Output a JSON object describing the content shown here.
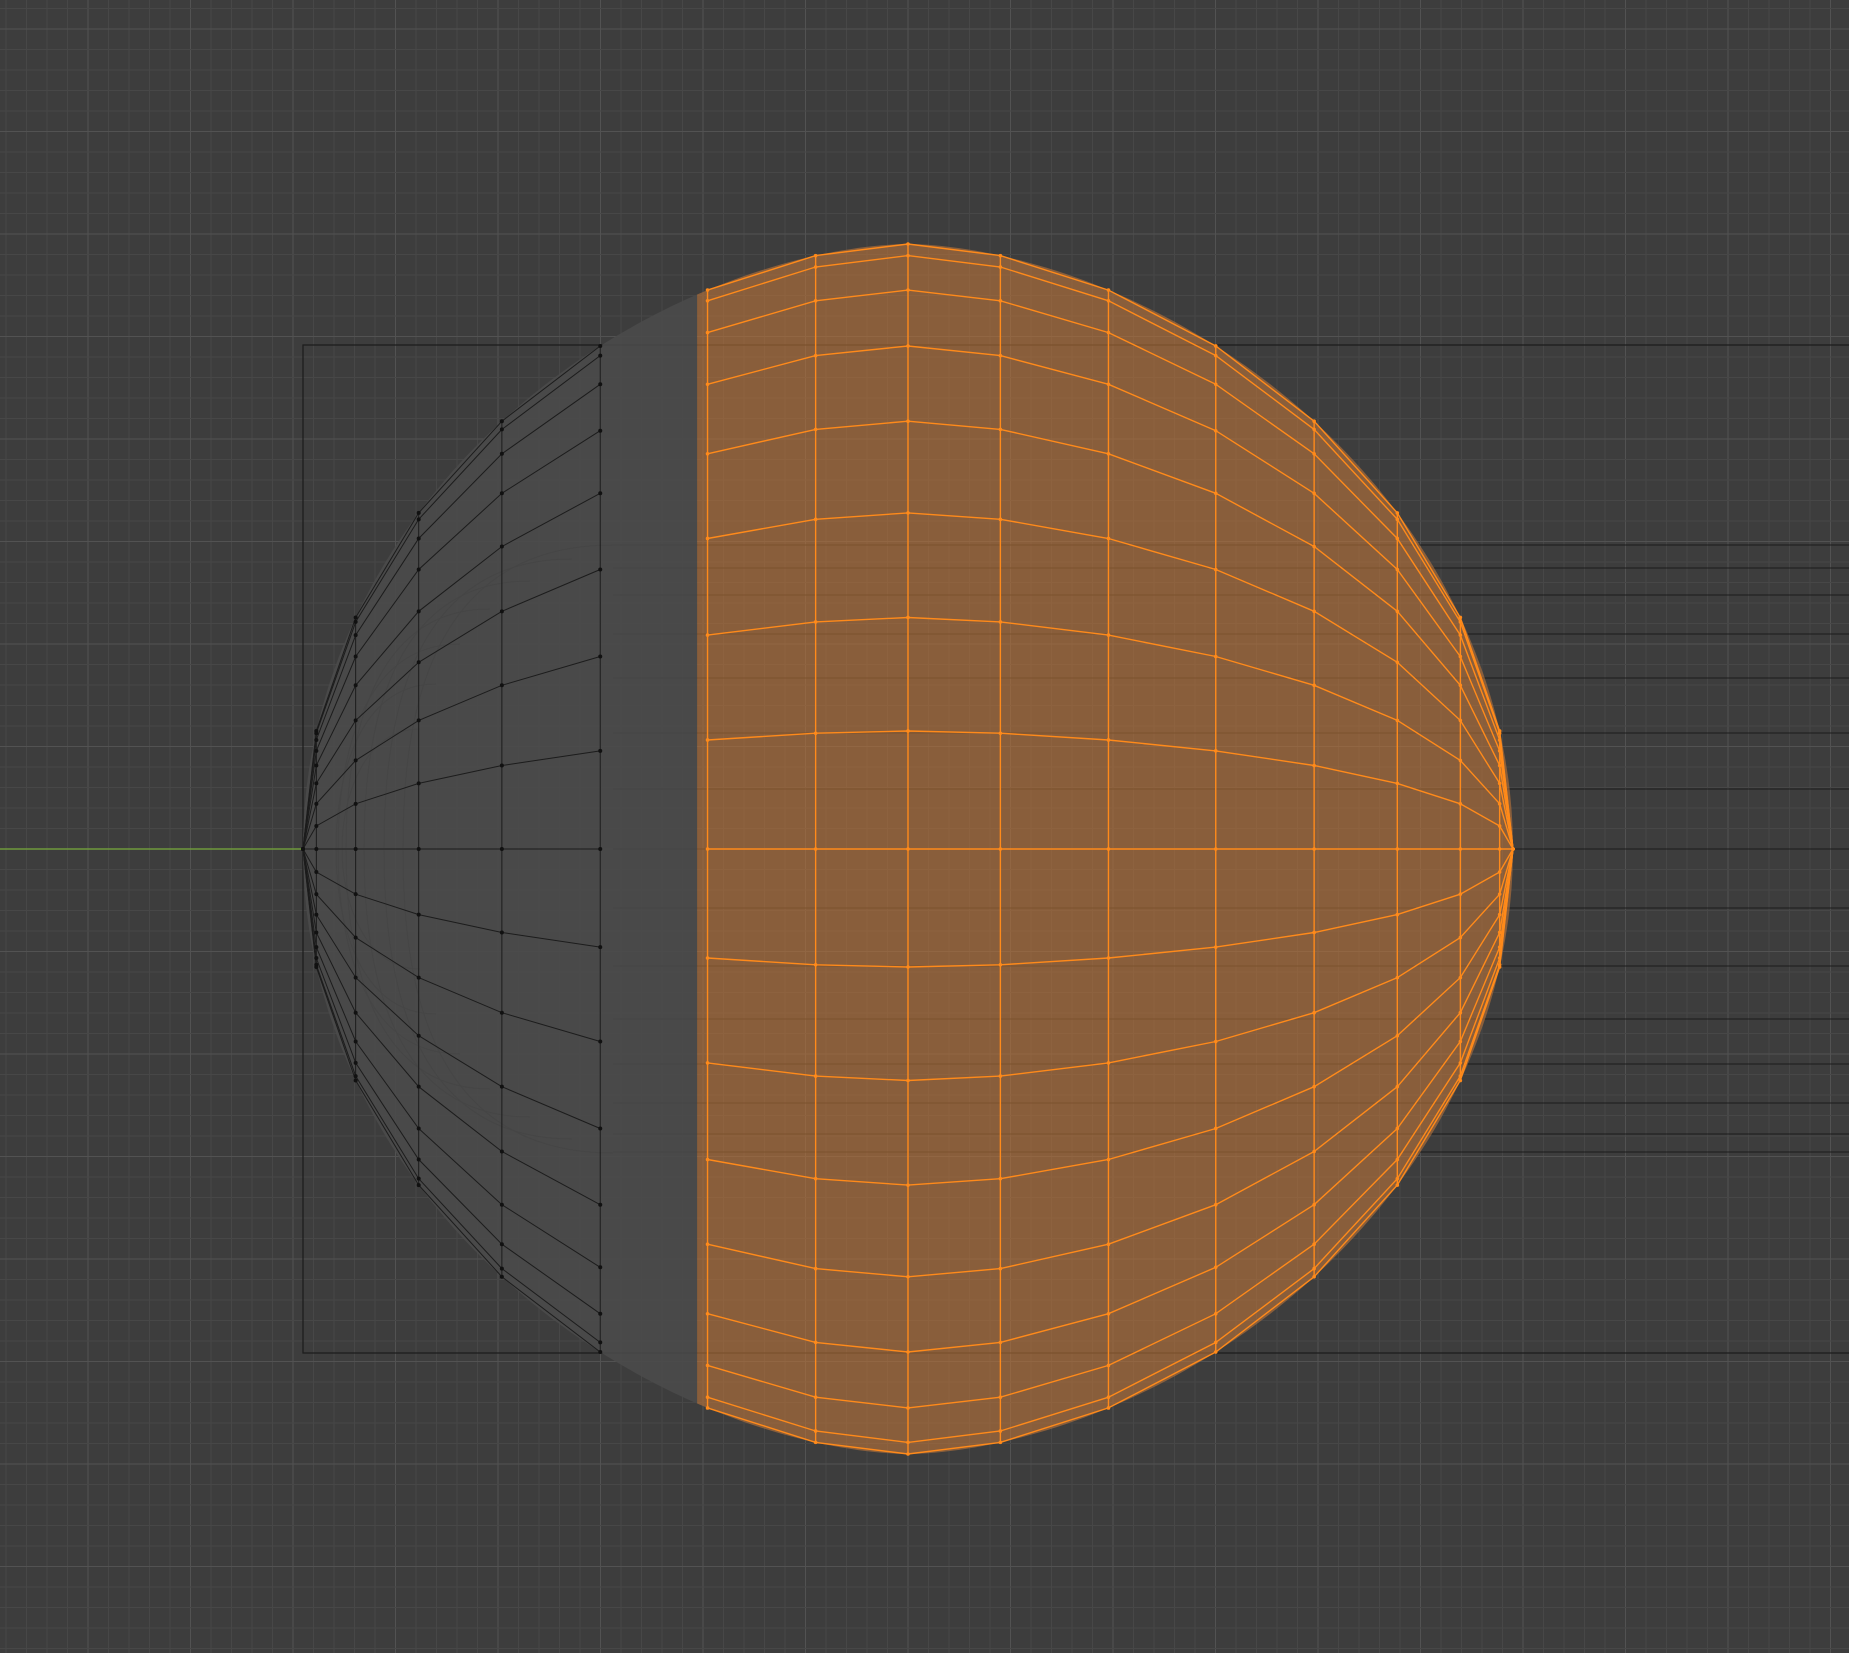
{
  "viewport": {
    "view": "front-orthographic",
    "background_color": "#3d3d3d",
    "grid_minor_color": "#474747",
    "grid_major_color": "#525252",
    "x_axis_color": "#6f9a3c",
    "wire_unselected_color": "#1c1c1c",
    "vertex_unselected_color": "#111111",
    "selection_color": "#ff8a1a",
    "selection_fill_color": "#b8723a"
  },
  "mesh": {
    "type": "uv-sphere",
    "ring_count": 16,
    "visible_segments": 16,
    "selected_faces_fraction": 0.7,
    "deformed_by": "curve-object"
  },
  "curve": {
    "type": "bezier-guide",
    "shown_as": "wireframe"
  }
}
